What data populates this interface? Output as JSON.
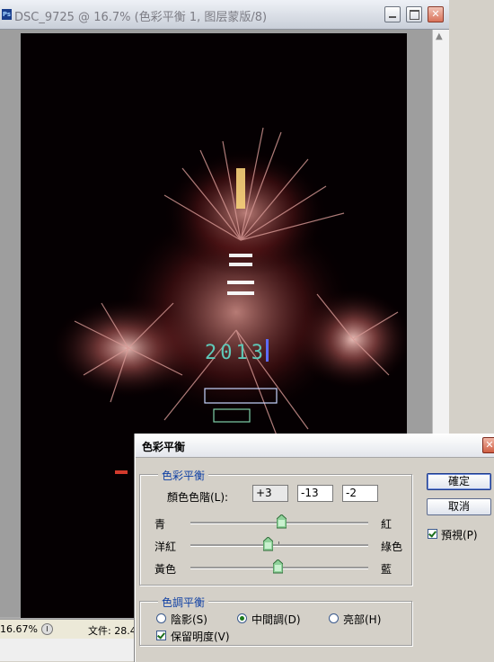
{
  "document": {
    "title": "DSC_9725 @ 16.7% (色彩平衡 1, 图层蒙版/8)",
    "app_icon": "Ps",
    "zoom": "16.67%",
    "file_info": "文件: 28.4",
    "photo_subject": "2013"
  },
  "dialog": {
    "title": "色彩平衡",
    "color_balance_group": "色彩平衡",
    "color_levels_label": "顏色色階(L):",
    "levels": [
      "+3",
      "-13",
      "-2"
    ],
    "sliders": [
      {
        "left": "青",
        "right": "紅",
        "value": 3
      },
      {
        "left": "洋紅",
        "right": "綠色",
        "value": -13
      },
      {
        "left": "黃色",
        "right": "藍",
        "value": -2
      }
    ],
    "tone_group": "色調平衡",
    "tones": [
      {
        "label": "陰影(S)",
        "selected": false
      },
      {
        "label": "中間調(D)",
        "selected": true
      },
      {
        "label": "亮部(H)",
        "selected": false
      }
    ],
    "preserve_luminosity": "保留明度(V)",
    "preserve_checked": true,
    "ok_label": "確定",
    "cancel_label": "取消",
    "preview_label": "預視(P)",
    "preview_checked": true
  },
  "colors": {
    "title_text": "#7c7c84",
    "group_legend": "#0d3ea3",
    "close_button": "#cf5e43"
  }
}
